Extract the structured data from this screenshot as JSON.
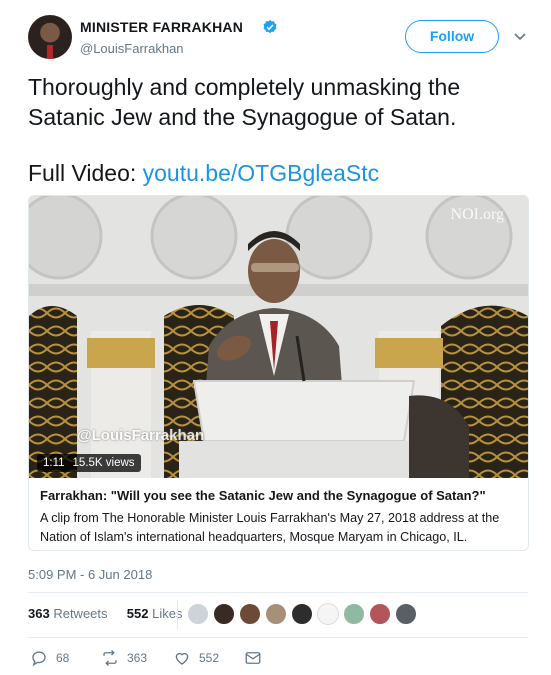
{
  "author": {
    "name": "MINISTER FARRAKHAN",
    "handle": "@LouisFarrakhan",
    "verified": true,
    "avatar_icon": "profile-photo"
  },
  "follow_label": "Follow",
  "tweet": {
    "line1": "Thoroughly and completely unmasking the",
    "line2": "Satanic Jew and the Synagogue of Satan.",
    "video_prefix": "Full Video: ",
    "video_link": "youtu.be/OTGBgleaStc"
  },
  "card": {
    "watermark_top": "NOI.org",
    "watermark_bottom": "@LouisFarrakhan",
    "duration": "1:11",
    "views": "15.5K views",
    "title": "Farrakhan: \"Will you see the Satanic Jew and the Synagogue of Satan?\"",
    "description": "A clip from The Honorable Minister Louis Farrakhan's May 27, 2018 address at the Nation of Islam's international headquarters, Mosque Maryam in Chicago, IL."
  },
  "timestamp": "5:09 PM - 6 Jun 2018",
  "stats": {
    "retweets_count": "363",
    "retweets_label": "Retweets",
    "likes_count": "552",
    "likes_label": "Likes"
  },
  "actions": {
    "replies": "68",
    "retweets": "363",
    "likes": "552"
  },
  "colors": {
    "link": "#1b95e0",
    "follow": "#1da1f2",
    "muted": "#657786"
  }
}
